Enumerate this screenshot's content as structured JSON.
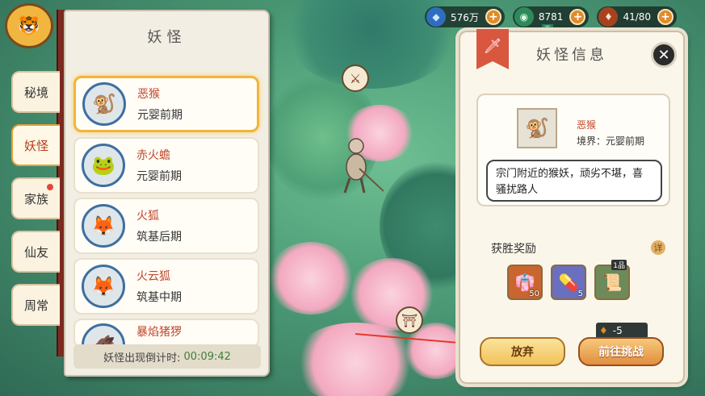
{
  "resources": [
    {
      "icon": "spirit-stone-icon",
      "value": "576万"
    },
    {
      "icon": "jade-icon",
      "value": "8781"
    },
    {
      "icon": "stamina-icon",
      "value": "41/80"
    }
  ],
  "sky_tag": "天",
  "nav_tabs": [
    {
      "label": "秘境",
      "active": false,
      "dot": false
    },
    {
      "label": "妖怪",
      "active": true,
      "dot": false
    },
    {
      "label": "家族",
      "active": false,
      "dot": true
    },
    {
      "label": "仙友",
      "active": false,
      "dot": false
    },
    {
      "label": "周常",
      "active": false,
      "dot": false
    }
  ],
  "monster_list": {
    "title": "妖怪",
    "items": [
      {
        "name": "恶猴",
        "realm": "元婴前期",
        "selected": true
      },
      {
        "name": "赤火蟾",
        "realm": "元婴前期",
        "selected": false
      },
      {
        "name": "火狐",
        "realm": "筑基后期",
        "selected": false
      },
      {
        "name": "火云狐",
        "realm": "筑基中期",
        "selected": false
      },
      {
        "name": "暴焰猪猡",
        "realm": "",
        "selected": false
      }
    ],
    "timer_label": "妖怪出现倒计时:",
    "timer_value": "00:09:42"
  },
  "info": {
    "title": "妖怪信息",
    "monster_name": "恶猴",
    "realm_text": "境界：元婴前期",
    "description": "宗门附近的猴妖，顽劣不堪，喜骚扰路人",
    "rewards_title": "获胜奖励",
    "info_icon_label": "详",
    "rewards": [
      {
        "icon": "robe-icon",
        "count": "50",
        "tag": ""
      },
      {
        "icon": "pill-icon",
        "count": "5",
        "tag": ""
      },
      {
        "icon": "scroll-icon",
        "count": "",
        "tag": "1品"
      }
    ],
    "cost": "-5",
    "give_up_label": "放弃",
    "challenge_label": "前往挑战"
  },
  "colors": {
    "accent_red": "#c0462a",
    "timer_green": "#3f7d3c",
    "selected_border": "#f2b43a"
  }
}
